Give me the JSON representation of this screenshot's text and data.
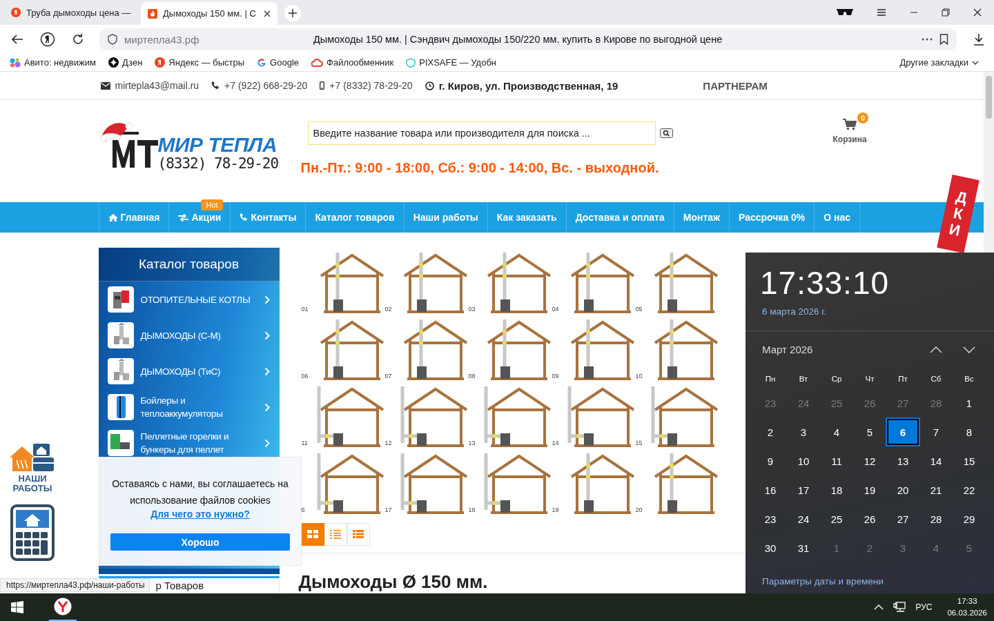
{
  "browser": {
    "tabs": [
      {
        "title": "Труба дымоходы цена — ",
        "selected": false
      },
      {
        "title": "Дымоходы 150 мм. | С",
        "selected": true
      }
    ],
    "address": {
      "url": "миртепла43.рф",
      "page_title": "Дымоходы 150 мм. | Сэндвич дымоходы 150/220 мм. купить в Кирове по выгодной цене"
    },
    "bookmarks": [
      "Авито: недвижим",
      "Дзен",
      "Яндекс — быстры",
      "Google",
      "Файлообменник",
      "PIXSAFE — Удобн"
    ],
    "other_bookmarks": "Другие закладки"
  },
  "site": {
    "topbar": {
      "email": "mirtepla43@mail.ru",
      "phone": "+7 (922) 668-29-20",
      "mobile": "+7 (8332) 78-29-20",
      "address": "г. Киров, ул. Производственная, 19",
      "partners": "ПАРТНЕРАМ"
    },
    "logo": {
      "name": "МИР ТЕПЛА",
      "phone": "(8332) 78-29-20"
    },
    "search": {
      "placeholder": "Введите название товара или производителя для поиска ..."
    },
    "hours": "Пн.-Пт.: 9:00 - 18:00, Сб.: 9:00 - 14:00, Вс. - выходной.",
    "cart": {
      "count": "0",
      "label": "Корзина"
    },
    "nav": [
      {
        "label": "Главная"
      },
      {
        "label": "Акции",
        "badge": "Hot"
      },
      {
        "label": "Контакты"
      },
      {
        "label": "Каталог товаров"
      },
      {
        "label": "Наши работы"
      },
      {
        "label": "Как заказать"
      },
      {
        "label": "Доставка и оплата"
      },
      {
        "label": "Монтаж"
      },
      {
        "label": "Рассрочка 0%"
      },
      {
        "label": "О нас"
      }
    ],
    "sidebar": {
      "title": "Каталог товаров",
      "items": [
        "ОТОПИТЕЛЬНЫЕ КОТЛЫ",
        "ДЫМОХОДЫ (С-М)",
        "ДЫМОХОДЫ (ТиС)",
        "Бойлеры и теплоаккумуляторы",
        "Пеллетные горелки и бункеры для пеллет"
      ]
    },
    "filter_title": "р Товаров",
    "diagrams": [
      {
        "label": "01",
        "kind": "inside"
      },
      {
        "label": "02",
        "kind": "inside"
      },
      {
        "label": "03",
        "kind": "inside"
      },
      {
        "label": "04",
        "kind": "inside"
      },
      {
        "label": "05",
        "kind": "inside"
      },
      {
        "label": "06",
        "kind": "inside"
      },
      {
        "label": "07",
        "kind": "inside"
      },
      {
        "label": "08",
        "kind": "inside"
      },
      {
        "label": "09",
        "kind": "inside"
      },
      {
        "label": "10",
        "kind": "inside"
      },
      {
        "label": "11",
        "kind": "outside"
      },
      {
        "label": "12",
        "kind": "outside"
      },
      {
        "label": "13",
        "kind": "outside"
      },
      {
        "label": "14",
        "kind": "outside"
      },
      {
        "label": "15",
        "kind": "outside"
      },
      {
        "label": "6",
        "kind": "outside"
      },
      {
        "label": "17",
        "kind": "outside"
      },
      {
        "label": "18",
        "kind": "outside"
      },
      {
        "label": "19",
        "kind": "inside"
      },
      {
        "label": "20",
        "kind": "inside"
      }
    ],
    "view_modes": [
      {
        "kind": "grid",
        "selected": true
      },
      {
        "kind": "list",
        "selected": false
      },
      {
        "kind": "table",
        "selected": false
      }
    ],
    "heading": "Дымоходы Ø 150 мм.",
    "sticker": "ДКИ",
    "works_label": "НАШИ РАБОТЫ"
  },
  "cookie": {
    "text": "Оставаясь с нами, вы соглашаетесь на использование файлов cookies",
    "link": "Для чего это нужно?",
    "button": "Хорошо"
  },
  "status_url": "https://миртепла43.рф/наши-работы",
  "clock_flyout": {
    "time": "17:33:10",
    "date": "6 марта 2026 г.",
    "month": "Март 2026",
    "weekdays": [
      "Пн",
      "Вт",
      "Ср",
      "Чт",
      "Пт",
      "Сб",
      "Вс"
    ],
    "days": [
      {
        "day": "23",
        "outside": true,
        "selected": false
      },
      {
        "day": "24",
        "outside": true,
        "selected": false
      },
      {
        "day": "25",
        "outside": true,
        "selected": false
      },
      {
        "day": "26",
        "outside": true,
        "selected": false
      },
      {
        "day": "27",
        "outside": true,
        "selected": false
      },
      {
        "day": "28",
        "outside": true,
        "selected": false
      },
      {
        "day": "1",
        "outside": false,
        "selected": false
      },
      {
        "day": "2",
        "outside": false,
        "selected": false
      },
      {
        "day": "3",
        "outside": false,
        "selected": false
      },
      {
        "day": "4",
        "outside": false,
        "selected": false
      },
      {
        "day": "5",
        "outside": false,
        "selected": false
      },
      {
        "day": "6",
        "outside": false,
        "selected": true
      },
      {
        "day": "7",
        "outside": false,
        "selected": false
      },
      {
        "day": "8",
        "outside": false,
        "selected": false
      },
      {
        "day": "9",
        "outside": false,
        "selected": false
      },
      {
        "day": "10",
        "outside": false,
        "selected": false
      },
      {
        "day": "11",
        "outside": false,
        "selected": false
      },
      {
        "day": "12",
        "outside": false,
        "selected": false
      },
      {
        "day": "13",
        "outside": false,
        "selected": false
      },
      {
        "day": "14",
        "outside": false,
        "selected": false
      },
      {
        "day": "15",
        "outside": false,
        "selected": false
      },
      {
        "day": "16",
        "outside": false,
        "selected": false
      },
      {
        "day": "17",
        "outside": false,
        "selected": false
      },
      {
        "day": "18",
        "outside": false,
        "selected": false
      },
      {
        "day": "19",
        "outside": false,
        "selected": false
      },
      {
        "day": "20",
        "outside": false,
        "selected": false
      },
      {
        "day": "21",
        "outside": false,
        "selected": false
      },
      {
        "day": "22",
        "outside": false,
        "selected": false
      },
      {
        "day": "23",
        "outside": false,
        "selected": false
      },
      {
        "day": "24",
        "outside": false,
        "selected": false
      },
      {
        "day": "25",
        "outside": false,
        "selected": false
      },
      {
        "day": "26",
        "outside": false,
        "selected": false
      },
      {
        "day": "27",
        "outside": false,
        "selected": false
      },
      {
        "day": "28",
        "outside": false,
        "selected": false
      },
      {
        "day": "29",
        "outside": false,
        "selected": false
      },
      {
        "day": "30",
        "outside": false,
        "selected": false
      },
      {
        "day": "31",
        "outside": false,
        "selected": false
      },
      {
        "day": "1",
        "outside": true,
        "selected": false
      },
      {
        "day": "2",
        "outside": true,
        "selected": false
      },
      {
        "day": "3",
        "outside": true,
        "selected": false
      },
      {
        "day": "4",
        "outside": true,
        "selected": false
      },
      {
        "day": "5",
        "outside": true,
        "selected": false
      }
    ],
    "settings_link": "Параметры даты и времени"
  },
  "taskbar": {
    "lang": "РУС",
    "time": "17:33",
    "date": "06.03.2026"
  }
}
